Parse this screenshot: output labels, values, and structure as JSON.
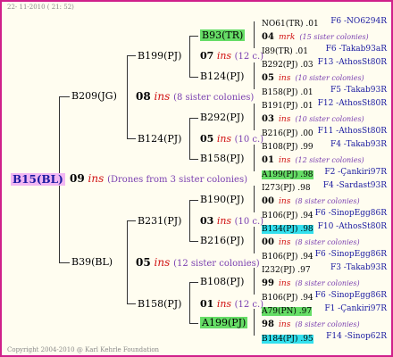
{
  "header": {
    "date": "22- 11-2010 ( 21: 52)"
  },
  "footer": {
    "copyright": "Copyright 2004-2010 @ Karl Kehrle Foundation"
  },
  "root": {
    "id": "B15(BL)",
    "num": "09",
    "ins": "ins",
    "note": "(Drones from 3 sister colonies)"
  },
  "gen2": [
    {
      "id": "B209(JG)",
      "num": "08",
      "ins": "ins",
      "note": "(8 sister colonies)"
    },
    {
      "id": "B39(BL)",
      "num": "05",
      "ins": "ins",
      "note": "(12 sister colonies)"
    }
  ],
  "gen3": [
    {
      "id": "B199(PJ)",
      "num": "07",
      "ins": "ins",
      "note": "(12 c.)"
    },
    {
      "id": "B124(PJ)",
      "num": "05",
      "ins": "ins",
      "note": "(10 c.)"
    },
    {
      "id": "B231(PJ)",
      "num": "03",
      "ins": "ins",
      "note": "(10 c.)"
    },
    {
      "id": "B158(PJ)",
      "num": "01",
      "ins": "ins",
      "note": "(12 c.)"
    }
  ],
  "gen4": [
    {
      "id": "B93(TR)"
    },
    {
      "id": "B124(PJ)"
    },
    {
      "id": "B292(PJ)"
    },
    {
      "id": "B158(PJ)"
    },
    {
      "id": "B190(PJ)"
    },
    {
      "id": "B216(PJ)"
    },
    {
      "id": "B108(PJ)"
    },
    {
      "id": "A199(PJ)"
    }
  ],
  "gen5": [
    {
      "a": "NO61(TR) .01",
      "b": "F6 -NO6294R"
    },
    {
      "num": "04",
      "ins": "mrk",
      "note": "(15 sister colonies)"
    },
    {
      "a": "I89(TR) .01",
      "b": "F6 -Takab93aR"
    },
    {
      "a": "B292(PJ) .03",
      "b": "F13 -AthosSt80R"
    },
    {
      "num": "05",
      "ins": "ins",
      "note": "(10 sister colonies)"
    },
    {
      "a": "B158(PJ) .01",
      "b": "F5 -Takab93R"
    },
    {
      "a": "B191(PJ) .01",
      "b": "F12 -AthosSt80R"
    },
    {
      "num": "03",
      "ins": "ins",
      "note": "(10 sister colonies)"
    },
    {
      "a": "B216(PJ) .00",
      "b": "F11 -AthosSt80R"
    },
    {
      "a": "B108(PJ) .99",
      "b": "F4 -Takab93R"
    },
    {
      "num": "01",
      "ins": "ins",
      "note": "(12 sister colonies)"
    },
    {
      "a": "A199(PJ) .98",
      "b": "F2 -Çankiri97R"
    },
    {
      "a": "I273(PJ) .98",
      "b": "F4 -Sardast93R"
    },
    {
      "num": "00",
      "ins": "ins",
      "note": "(8 sister colonies)"
    },
    {
      "a": "B106(PJ) .94",
      "b": "F6 -SinopEgg86R"
    },
    {
      "a": "B134(PJ) .98",
      "b": "F10 -AthosSt80R"
    },
    {
      "num": "00",
      "ins": "ins",
      "note": "(8 sister colonies)"
    },
    {
      "a": "B106(PJ) .94",
      "b": "F6 -SinopEgg86R"
    },
    {
      "a": "I232(PJ) .97",
      "b": "F3 -Takab93R"
    },
    {
      "num": "99",
      "ins": "ins",
      "note": "(8 sister colonies)"
    },
    {
      "a": "B106(PJ) .94",
      "b": "F6 -SinopEgg86R"
    },
    {
      "a": "A79(PN) .97",
      "b": "F1 -Çankiri97R"
    },
    {
      "num": "98",
      "ins": "ins",
      "note": "(8 sister colonies)"
    },
    {
      "a": "B184(PJ) .95",
      "b": "F14 -Sinop62R"
    }
  ]
}
